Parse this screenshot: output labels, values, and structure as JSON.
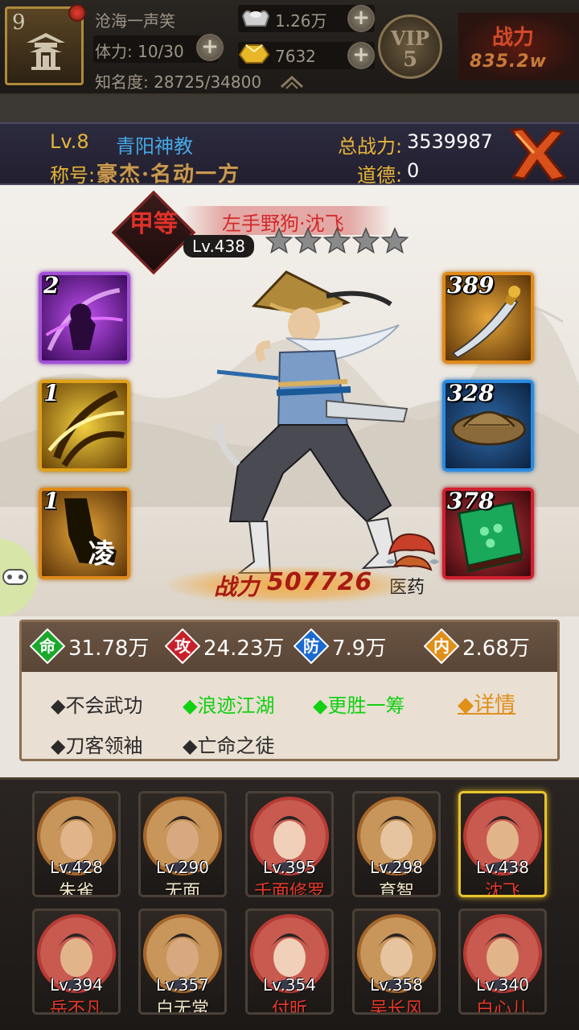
{
  "topbar": {
    "player_level": "9",
    "player_name": "沧海一声笑",
    "stamina": "体力: 10/30",
    "fame": "知名度: 28725/34800",
    "silver": "1.26万",
    "gold": "7632",
    "vip_label": "VIP",
    "vip_level": "5",
    "power_label": "战力",
    "power_value": "835.2w"
  },
  "header": {
    "level": "Lv.8",
    "sect": "青阳神教",
    "total_power_label": "总战力:",
    "total_power": "3539987",
    "title_label": "称号:",
    "title": "豪杰·名动一方",
    "morality_label": "道德:",
    "morality": "0"
  },
  "hero": {
    "grade": "甲等",
    "name": "左手野狗·沈飞",
    "level": "Lv.438",
    "stars": 5,
    "power_label": "战力",
    "power": "507726",
    "medicine_label": "医药"
  },
  "skills": [
    {
      "count": "2",
      "type": "purple"
    },
    {
      "count": "1",
      "type": "gold"
    },
    {
      "count": "1",
      "type": "orange",
      "glyph": "凌"
    }
  ],
  "equipment": [
    {
      "level": "389",
      "item": "saber",
      "type": "orange"
    },
    {
      "level": "328",
      "item": "straw-hat",
      "type": "blue"
    },
    {
      "level": "378",
      "item": "manual",
      "type": "red"
    }
  ],
  "attributes": [
    {
      "icon": "命",
      "value": "31.78万",
      "color": "#1aa82a"
    },
    {
      "icon": "攻",
      "value": "24.23万",
      "color": "#c8202a"
    },
    {
      "icon": "防",
      "value": "7.9万",
      "color": "#1a6ad0"
    },
    {
      "icon": "内",
      "value": "2.68万",
      "color": "#e0901a"
    }
  ],
  "traits": [
    {
      "text": "◆不会武功",
      "active": false
    },
    {
      "text": "◆浪迹江湖",
      "active": true
    },
    {
      "text": "◆更胜一筹",
      "active": true
    },
    {
      "text": "◆刀客领袖",
      "active": false
    },
    {
      "text": "◆亡命之徒",
      "active": false
    }
  ],
  "detail_link": "◆详情",
  "roster": [
    {
      "level": "Lv.428",
      "name": "朱雀",
      "name_color": "#f0e6c8",
      "ring": "gold"
    },
    {
      "level": "Lv.290",
      "name": "无面",
      "name_color": "#f0e6c8",
      "ring": "gold"
    },
    {
      "level": "Lv.395",
      "name": "千面修罗",
      "name_color": "#e83a2a",
      "ring": "red"
    },
    {
      "level": "Lv.298",
      "name": "育智",
      "name_color": "#f0e6c8",
      "ring": "gold"
    },
    {
      "level": "Lv.438",
      "name": "沈飞",
      "name_color": "#e83a2a",
      "ring": "red",
      "selected": true
    },
    {
      "level": "Lv.394",
      "name": "岳不凡",
      "name_color": "#e83a2a",
      "ring": "red"
    },
    {
      "level": "Lv.357",
      "name": "白无常",
      "name_color": "#f0e6c8",
      "ring": "gold"
    },
    {
      "level": "Lv.354",
      "name": "付昕",
      "name_color": "#e83a2a",
      "ring": "red"
    },
    {
      "level": "Lv.358",
      "name": "吴长风",
      "name_color": "#e83a2a",
      "ring": "gold"
    },
    {
      "level": "Lv.340",
      "name": "白心儿",
      "name_color": "#e83a2a",
      "ring": "red"
    }
  ]
}
